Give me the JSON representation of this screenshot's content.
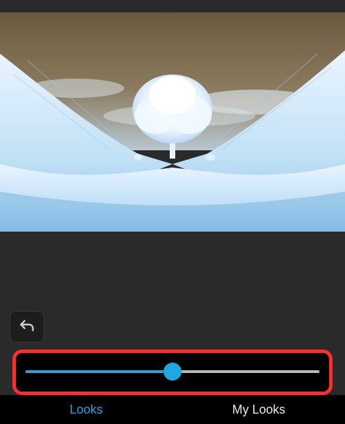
{
  "canvas": {
    "filter_applied": "Invert",
    "alt": "photo-preview-inverted"
  },
  "controls": {
    "undo_icon": "undo-icon"
  },
  "slider": {
    "value": 50,
    "min": 0,
    "max": 100,
    "fill_color": "#1ea7e0",
    "track_color": "#b9b9b9"
  },
  "tabs": {
    "items": [
      {
        "label": "Looks",
        "active": true
      },
      {
        "label": "My Looks",
        "active": false
      }
    ]
  },
  "highlight": {
    "target": "intensity-slider",
    "color": "#ff2d2d"
  }
}
